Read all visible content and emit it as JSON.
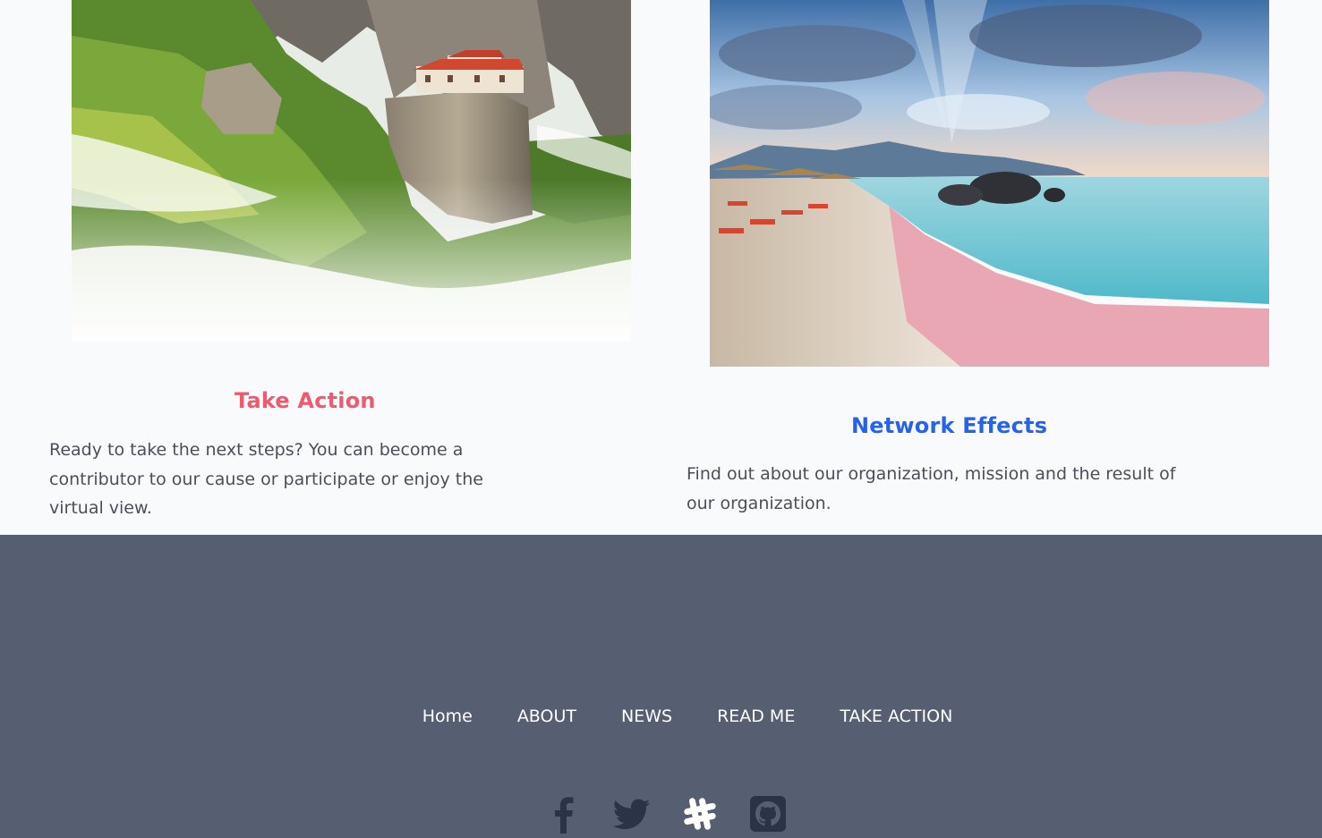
{
  "cards": [
    {
      "image": "meteora-monastery-photo",
      "title": "Take Action",
      "text": "Ready to take the next steps? You can become a contributor to our cause or participate or enjoy the virtual view.",
      "title_color": "#ef5a6f"
    },
    {
      "image": "pink-sand-beach-photo",
      "title": "Network Effects",
      "text": "Find out about our organization, mission and the result of our organization.",
      "title_color": "#2563eb"
    }
  ],
  "footer": {
    "background": "#565e72",
    "nav": [
      "Home",
      "ABOUT",
      "NEWS",
      "READ ME",
      "TAKE ACTION"
    ],
    "social": [
      {
        "icon": "facebook-icon",
        "color": "#2b3347"
      },
      {
        "icon": "twitter-icon",
        "color": "#2b3347"
      },
      {
        "icon": "slack-icon",
        "color": "#ffffff"
      },
      {
        "icon": "github-icon",
        "color": "#2b3347"
      }
    ]
  }
}
